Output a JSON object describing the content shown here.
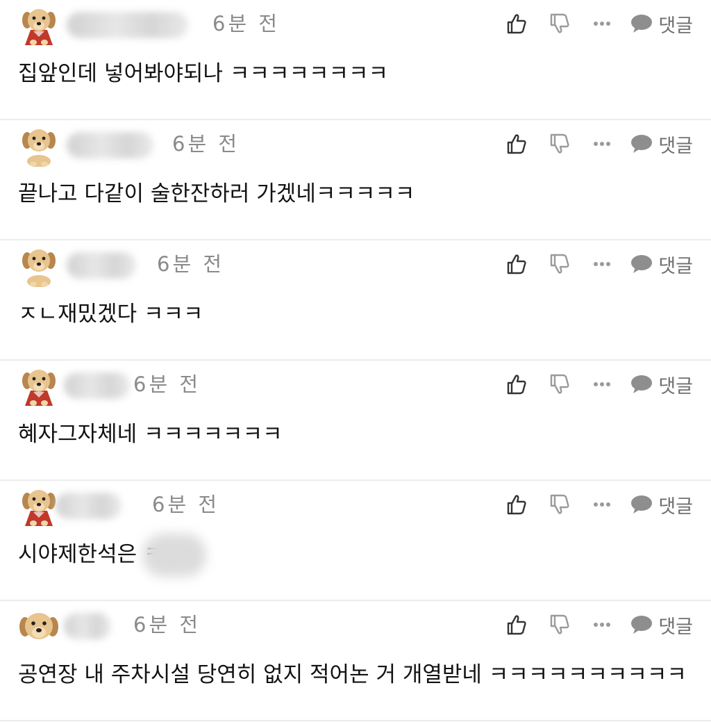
{
  "comments": [
    {
      "time": "6분 전",
      "text": "집앞인데 넣어봐야되나 ㅋㅋㅋㅋㅋㅋㅋㅋ",
      "reply_label": "댓글",
      "avatar": "dog-cape"
    },
    {
      "time": "6분 전",
      "text": "끝나고 다같이 술한잔하러 가겠네ㅋㅋㅋㅋㅋ",
      "reply_label": "댓글",
      "avatar": "dog"
    },
    {
      "time": "6분 전",
      "text": "ㅈㄴ재밌겠다 ㅋㅋㅋ",
      "reply_label": "댓글",
      "avatar": "dog"
    },
    {
      "time": "6분 전",
      "text": "혜자그자체네 ㅋㅋㅋㅋㅋㅋㅋ",
      "reply_label": "댓글",
      "avatar": "dog-cape"
    },
    {
      "time": "6분 전",
      "text": "시야제한석은 ㅋㅋ",
      "reply_label": "댓글",
      "avatar": "dog-cape"
    },
    {
      "time": "6분 전",
      "text": "공연장 내 주차시설 당연히 없지 적어논 거 개열받네 ㅋㅋㅋㅋㅋㅋㅋㅋㅋㅋ",
      "reply_label": "댓글",
      "avatar": "dog-face"
    }
  ],
  "icons": {
    "like": "thumbs-up-icon",
    "dislike": "thumbs-down-icon",
    "more": "more-dots-icon",
    "reply": "speech-bubble-icon"
  },
  "colors": {
    "meta_text": "#8a8a8a",
    "icon": "#333333",
    "divider": "#ececec",
    "cape": "#c0392b",
    "dog_fur": "#e8c48e"
  }
}
